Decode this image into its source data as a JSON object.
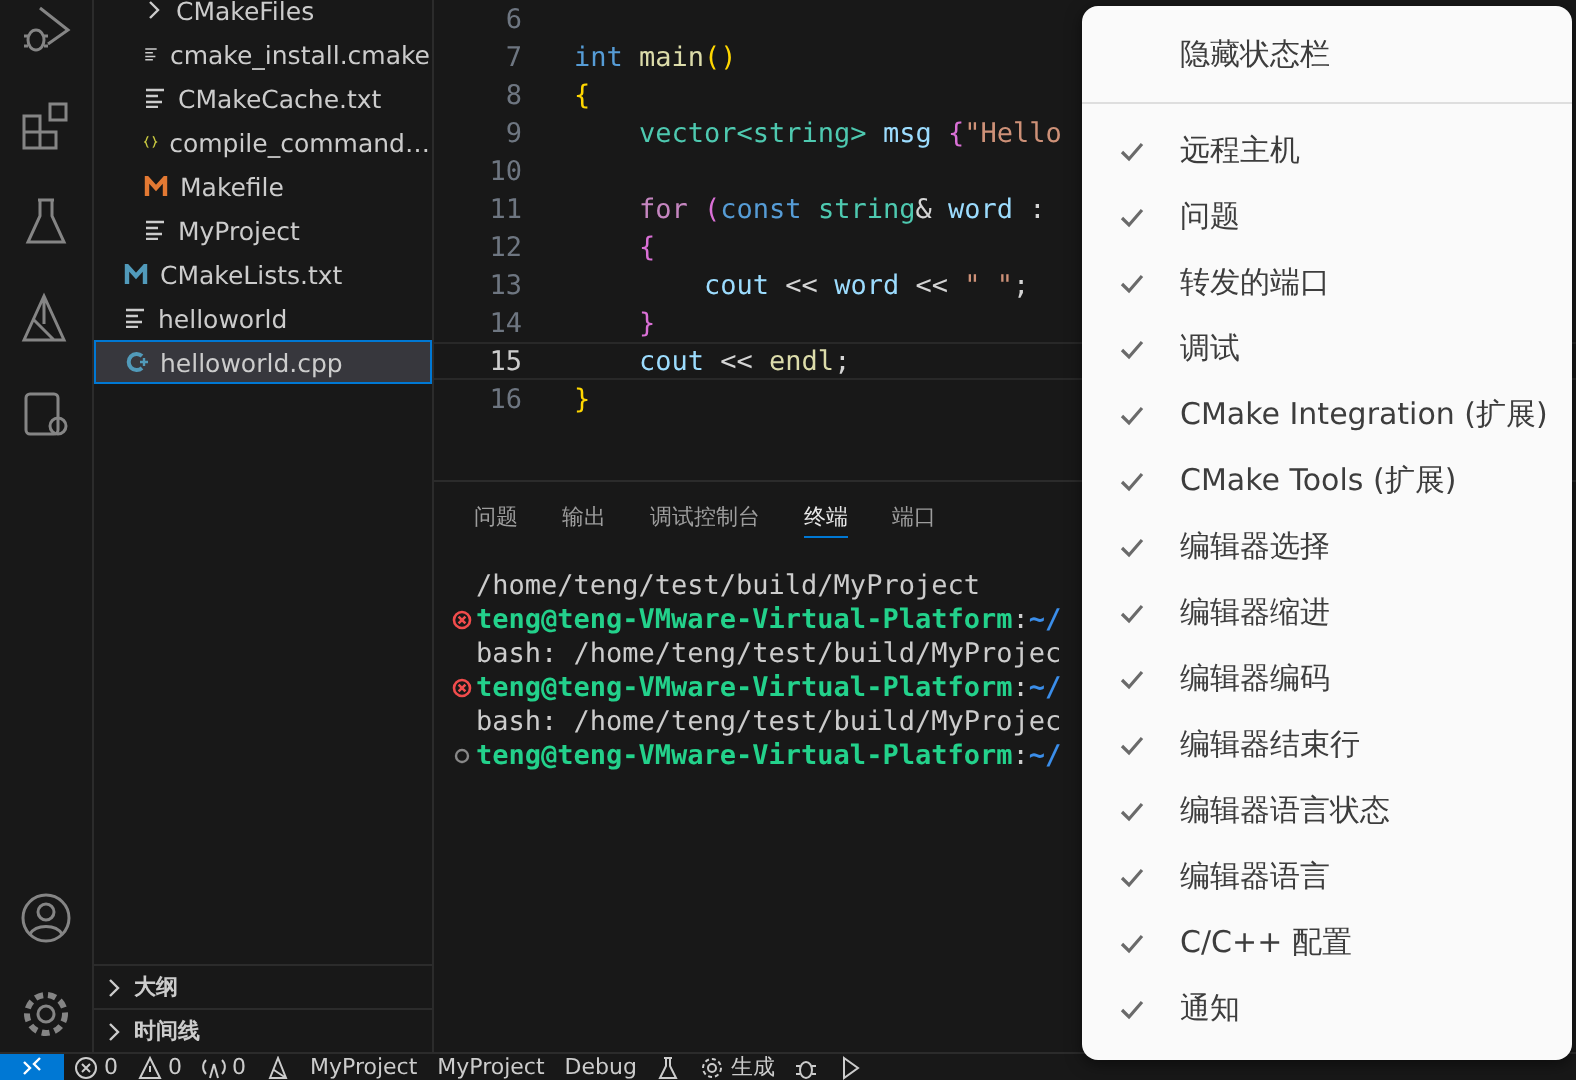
{
  "explorer": {
    "items": [
      {
        "children": [
          {
            "label": "CMakeFiles",
            "kind": "folder",
            "selected": false
          },
          {
            "label": "cmake_install.cmake",
            "kind": "text",
            "selected": false
          },
          {
            "label": "CMakeCache.txt",
            "kind": "text",
            "selected": false
          },
          {
            "label": "compile_command…",
            "kind": "json",
            "selected": false
          },
          {
            "label": "Makefile",
            "kind": "makefile",
            "selected": false
          },
          {
            "label": "MyProject",
            "kind": "text",
            "selected": false
          }
        ]
      },
      {
        "label": "CMakeLists.txt",
        "kind": "cmake",
        "selected": false
      },
      {
        "label": "helloworld",
        "kind": "text",
        "selected": false
      },
      {
        "label": "helloworld.cpp",
        "kind": "cpp",
        "selected": true
      }
    ],
    "sections": [
      "大纲",
      "时间线"
    ]
  },
  "editor": {
    "lines": [
      {
        "number": "6",
        "current": false
      },
      {
        "number": "7",
        "current": false,
        "tokens": [
          {
            "kind": "keyword",
            "t": "int "
          },
          {
            "kind": "func",
            "t": "main"
          },
          {
            "kind": "bracket1",
            "t": "()"
          }
        ]
      },
      {
        "number": "8",
        "current": false,
        "tokens": [
          {
            "kind": "bracket1",
            "t": "{"
          }
        ]
      },
      {
        "number": "9",
        "current": false,
        "tokens": [
          {
            "kind": "type",
            "t": "    vector<string> "
          },
          {
            "kind": "var",
            "t": "msg "
          },
          {
            "kind": "bracket2",
            "t": "{"
          },
          {
            "kind": "string",
            "t": "\"Hello"
          }
        ]
      },
      {
        "number": "10",
        "current": false
      },
      {
        "number": "11",
        "current": false,
        "tokens": [
          {
            "kind": "control",
            "t": "    for "
          },
          {
            "kind": "bracket2",
            "t": "("
          },
          {
            "kind": "keyword",
            "t": "const "
          },
          {
            "kind": "type",
            "t": "string"
          },
          {
            "kind": "plain",
            "t": "& "
          },
          {
            "kind": "var",
            "t": "word"
          },
          {
            "kind": "plain",
            "t": " : "
          }
        ]
      },
      {
        "number": "12",
        "current": false,
        "tokens": [
          {
            "kind": "bracket2",
            "t": "    {"
          }
        ]
      },
      {
        "number": "13",
        "current": false,
        "tokens": [
          {
            "kind": "var",
            "t": "        cout"
          },
          {
            "kind": "plain",
            "t": " << "
          },
          {
            "kind": "var",
            "t": "word"
          },
          {
            "kind": "plain",
            "t": " << "
          },
          {
            "kind": "string",
            "t": "\" \""
          },
          {
            "kind": "plain",
            "t": ";"
          }
        ]
      },
      {
        "number": "14",
        "current": false,
        "tokens": [
          {
            "kind": "bracket2",
            "t": "    }"
          }
        ]
      },
      {
        "number": "15",
        "current": true,
        "tokens": [
          {
            "kind": "var",
            "t": "    cout"
          },
          {
            "kind": "plain",
            "t": " << "
          },
          {
            "kind": "func",
            "t": "endl"
          },
          {
            "kind": "plain",
            "t": ";"
          }
        ]
      },
      {
        "number": "16",
        "current": false,
        "tokens": [
          {
            "kind": "bracket1",
            "t": "}"
          }
        ]
      }
    ]
  },
  "panel": {
    "tabs": [
      {
        "label": "问题",
        "selected": false
      },
      {
        "label": "输出",
        "selected": false
      },
      {
        "label": "调试控制台",
        "selected": false
      },
      {
        "label": "终端",
        "selected": true
      },
      {
        "label": "端口",
        "selected": false
      }
    ],
    "terminal": [
      {
        "kind": "output",
        "segments": [
          {
            "kind": "plain",
            "t": "/home/teng/test/build/MyProject"
          }
        ]
      },
      {
        "kind": "failed",
        "segments": [
          {
            "kind": "prompt",
            "t": "teng@teng-VMware-Virtual-Platform"
          },
          {
            "kind": "plain",
            "t": ":"
          },
          {
            "kind": "path",
            "t": "~/"
          }
        ]
      },
      {
        "kind": "output",
        "segments": [
          {
            "kind": "plain",
            "t": "bash: /home/teng/test/build/MyProjec"
          }
        ]
      },
      {
        "kind": "failed",
        "segments": [
          {
            "kind": "prompt",
            "t": "teng@teng-VMware-Virtual-Platform"
          },
          {
            "kind": "plain",
            "t": ":"
          },
          {
            "kind": "path",
            "t": "~/"
          }
        ]
      },
      {
        "kind": "output",
        "segments": [
          {
            "kind": "plain",
            "t": "bash: /home/teng/test/build/MyProjec"
          }
        ]
      },
      {
        "kind": "pending",
        "segments": [
          {
            "kind": "prompt",
            "t": "teng@teng-VMware-Virtual-Platform"
          },
          {
            "kind": "plain",
            "t": ":"
          },
          {
            "kind": "path",
            "t": "~/"
          }
        ]
      }
    ]
  },
  "status_bar": {
    "items": [
      {
        "kind": "remote"
      },
      {
        "kind": "error",
        "text": "0"
      },
      {
        "kind": "warning",
        "text": "0"
      },
      {
        "kind": "ports",
        "text": "0"
      },
      {
        "kind": "cmake"
      },
      {
        "kind": "text",
        "text": "MyProject"
      },
      {
        "kind": "text",
        "text": "MyProject"
      },
      {
        "kind": "text",
        "text": "Debug"
      },
      {
        "kind": "flask"
      },
      {
        "kind": "build",
        "text": "生成"
      },
      {
        "kind": "bug"
      },
      {
        "kind": "play"
      }
    ]
  },
  "context_menu": {
    "header": "隐藏状态栏",
    "items": [
      {
        "label": "远程主机",
        "checked": true
      },
      {
        "label": "问题",
        "checked": true
      },
      {
        "label": "转发的端口",
        "checked": true
      },
      {
        "label": "调试",
        "checked": true
      },
      {
        "label": "CMake Integration (扩展)",
        "checked": true
      },
      {
        "label": "CMake Tools (扩展)",
        "checked": true
      },
      {
        "label": "编辑器选择",
        "checked": true
      },
      {
        "label": "编辑器缩进",
        "checked": true
      },
      {
        "label": "编辑器编码",
        "checked": true
      },
      {
        "label": "编辑器结束行",
        "checked": true
      },
      {
        "label": "编辑器语言状态",
        "checked": true
      },
      {
        "label": "编辑器语言",
        "checked": true
      },
      {
        "label": "C/C++ 配置",
        "checked": true
      },
      {
        "label": "通知",
        "checked": true
      }
    ]
  }
}
